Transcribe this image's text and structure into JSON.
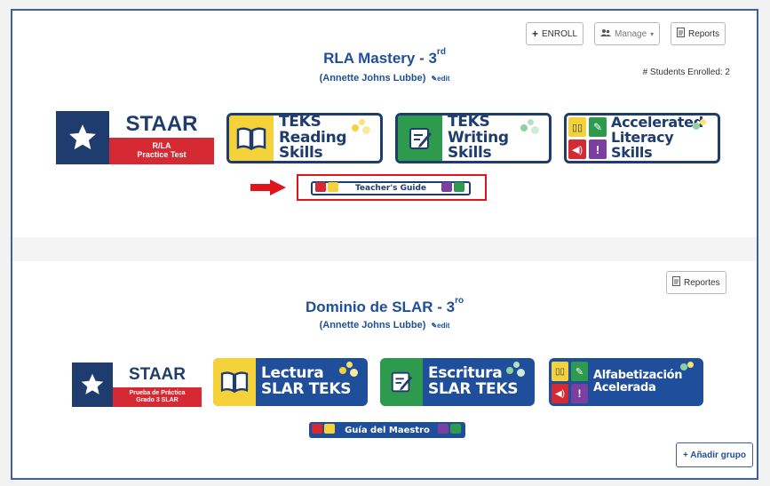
{
  "course1": {
    "title": "RLA Mastery - 3",
    "title_sup": "rd",
    "teacher": "(Annette Johns Lubbe)",
    "edit_label": "edit",
    "enroll_label": "ENROLL",
    "manage_label": "Manage",
    "reports_label": "Reports",
    "enrolled_text": "# Students Enrolled: 2",
    "staar": {
      "word": "STAAR",
      "line1": "R/LA",
      "line2": "Practice Test"
    },
    "tiles": [
      {
        "line1": "TEKS",
        "line2": "Reading Skills"
      },
      {
        "line1": "TEKS",
        "line2": "Writing Skills"
      },
      {
        "line1": "Accelerated",
        "line2": "Literacy Skills"
      }
    ],
    "guide_label": "Teacher's Guide"
  },
  "course2": {
    "title": "Dominio de SLAR - 3",
    "title_sup": "ro",
    "teacher": "(Annette Johns Lubbe)",
    "edit_label": "edit",
    "reports_label": "Reportes",
    "staar": {
      "word": "STAAR",
      "line1": "Prueba de Práctica",
      "line2": "Grado 3 SLAR"
    },
    "tiles": [
      {
        "line1": "Lectura",
        "line2": "SLAR TEKS"
      },
      {
        "line1": "Escritura",
        "line2": "SLAR TEKS"
      },
      {
        "line1": "Alfabetización",
        "line2": "Acelerada"
      }
    ],
    "guide_label": "Guía del Maestro",
    "add_group_label": "+ Añadir grupo"
  },
  "colors": {
    "brand_blue": "#1f4f9b",
    "navy": "#1f3c6e",
    "staar_red": "#d52a33",
    "teks_yellow": "#f6d23a",
    "teks_green": "#2e9a4d",
    "accent_purple": "#7a3fa0",
    "highlight_red": "#e1141c"
  },
  "icons": [
    "plus-icon",
    "users-icon",
    "caret-down-icon",
    "report-icon",
    "pencil-icon",
    "star-icon",
    "book-icon",
    "notepad-icon",
    "speaker-icon",
    "exclamation-icon",
    "red-arrow-icon"
  ]
}
